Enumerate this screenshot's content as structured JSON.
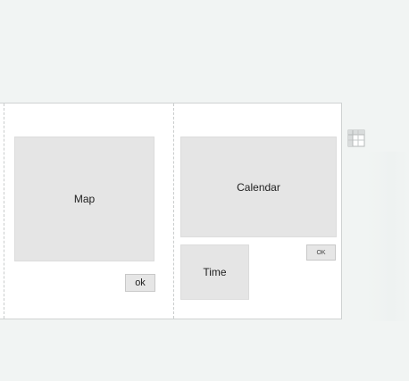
{
  "panel": {
    "map": {
      "label": "Map",
      "ok_label": "ok"
    },
    "calendar": {
      "label": "Calendar",
      "ok_label": "OK"
    },
    "time": {
      "label": "Time"
    }
  },
  "icons": {
    "corner": "table-corner-icon"
  },
  "colors": {
    "background": "#f1f4f3",
    "panel": "#ffffff",
    "placeholder": "#e5e5e5"
  }
}
